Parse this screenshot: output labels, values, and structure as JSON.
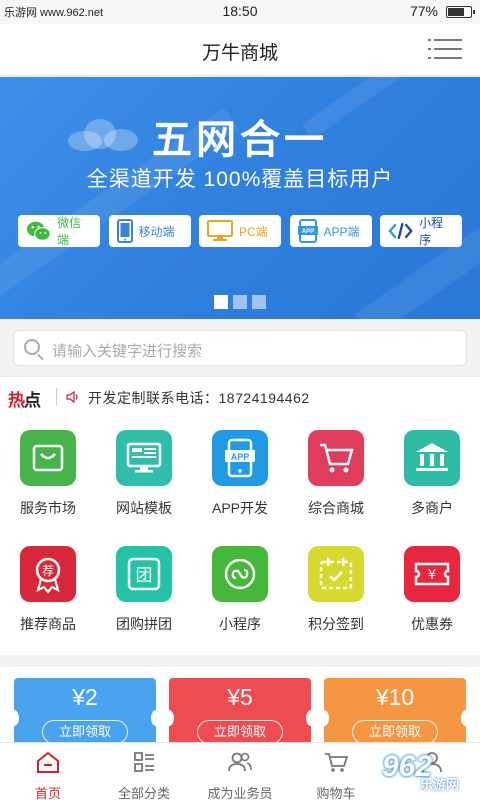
{
  "status_bar": {
    "watermark": "乐游网 www.962.net",
    "time": "18:50",
    "battery": "77%",
    "battery_level": 0.77
  },
  "header": {
    "title": "万牛商城"
  },
  "banner": {
    "headline": "五网合一",
    "subtitle": "全渠道开发  100%覆盖目标用户",
    "chips": [
      {
        "label": "微信端",
        "icon": "wechat-icon",
        "color": "#3dbb3c"
      },
      {
        "label": "移动端",
        "icon": "mobile-icon",
        "color": "#3d82d8"
      },
      {
        "label": "PC端",
        "icon": "monitor-icon",
        "color": "#f0a21c"
      },
      {
        "label": "APP端",
        "icon": "app-icon",
        "color": "#2e9be0"
      },
      {
        "label": "小程序",
        "icon": "code-icon",
        "color": "#1f4f9a"
      }
    ],
    "active_slide": 0
  },
  "search": {
    "placeholder": "请输入关键字进行搜索"
  },
  "hot": {
    "tag_a": "热",
    "tag_b": "点",
    "text": "开发定制联系电话：18724194462"
  },
  "grid": [
    {
      "label": "服务市场",
      "icon": "shopping-bag-icon",
      "color": "#46b44a"
    },
    {
      "label": "网站模板",
      "icon": "monitor-template-icon",
      "color": "#2fbfa8"
    },
    {
      "label": "APP开发",
      "icon": "app-phone-icon",
      "color": "#1f9be6"
    },
    {
      "label": "综合商城",
      "icon": "cart-icon",
      "color": "#e03c5c"
    },
    {
      "label": "多商户",
      "icon": "bank-icon",
      "color": "#2dbba4"
    },
    {
      "label": "推荐商品",
      "icon": "badge-icon",
      "color": "#d8263a"
    },
    {
      "label": "团购拼团",
      "icon": "group-icon",
      "color": "#25c3a6"
    },
    {
      "label": "小程序",
      "icon": "miniprogram-icon",
      "color": "#45b83a"
    },
    {
      "label": "积分签到",
      "icon": "calendar-icon",
      "color": "#d6d92e"
    },
    {
      "label": "优惠券",
      "icon": "ticket-icon",
      "color": "#e8263d"
    }
  ],
  "coupons": [
    {
      "amount": "¥2",
      "action": "立即领取",
      "color": "#4aa3ef"
    },
    {
      "amount": "¥5",
      "action": "立即领取",
      "color": "#ef4c52"
    },
    {
      "amount": "¥10",
      "action": "立即领取",
      "color": "#f59643"
    }
  ],
  "tabbar": [
    {
      "label": "首页",
      "icon": "home-icon",
      "active": true
    },
    {
      "label": "全部分类",
      "icon": "category-icon",
      "active": false
    },
    {
      "label": "成为业务员",
      "icon": "users-icon",
      "active": false
    },
    {
      "label": "购物车",
      "icon": "cart-tab-icon",
      "active": false
    },
    {
      "label": "",
      "icon": "user-icon",
      "active": false
    }
  ],
  "site_logo": {
    "number": "962",
    "text": "乐游网"
  },
  "colors": {
    "accent": "#d8202b",
    "banner": "#3d8fe8"
  }
}
